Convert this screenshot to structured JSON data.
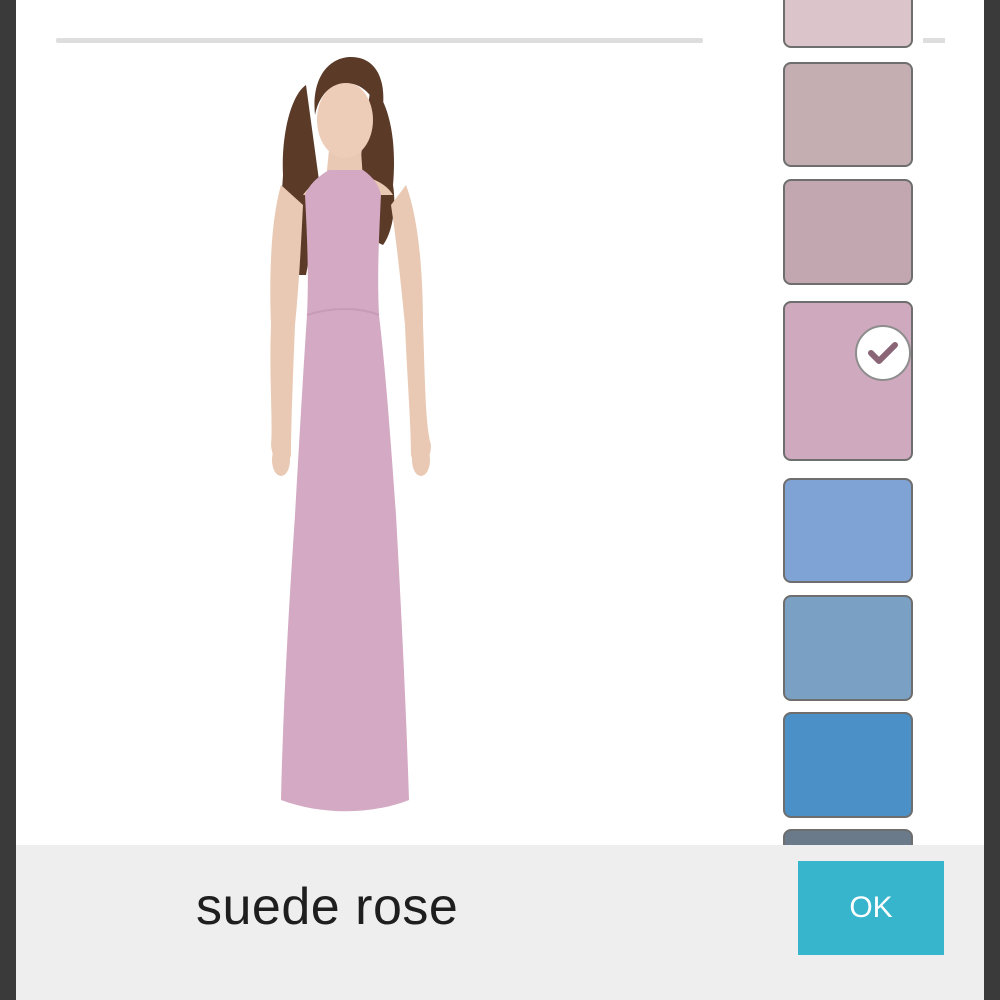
{
  "dialog": {
    "selected_color_name": "suede rose",
    "ok_label": "OK"
  },
  "swatches": [
    {
      "color": "#dcc4cb",
      "selected": false
    },
    {
      "color": "#c4aeb2",
      "selected": false
    },
    {
      "color": "#c2a7b1",
      "selected": false
    },
    {
      "color": "#cfa9be",
      "selected": true
    },
    {
      "color": "#80a3d6",
      "selected": false
    },
    {
      "color": "#7aa0c3",
      "selected": false
    },
    {
      "color": "#4b90c7",
      "selected": false
    },
    {
      "color": "#6b7a8a",
      "selected": false
    }
  ],
  "product": {
    "dress_color": "#d3a9c3",
    "icon": "checkmark-icon"
  }
}
